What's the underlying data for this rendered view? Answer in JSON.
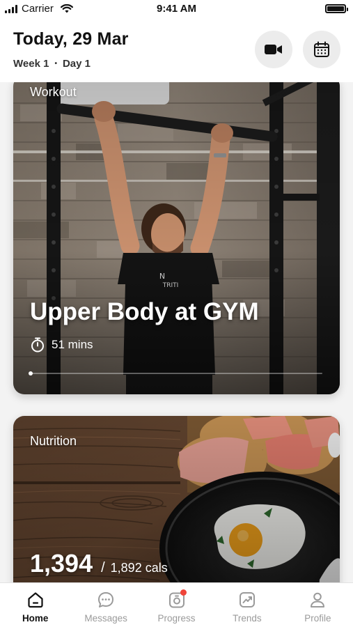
{
  "status_bar": {
    "carrier": "Carrier",
    "time": "9:41 AM"
  },
  "header": {
    "title": "Today, 29 Mar",
    "week": "Week 1",
    "separator": "•",
    "day": "Day 1"
  },
  "workout_card": {
    "label": "Workout",
    "title": "Upper Body at GYM",
    "duration": "51 mins",
    "progress": 0
  },
  "nutrition_card": {
    "label": "Nutrition",
    "calories": "1,394",
    "separator": "/",
    "target": "1,892 cals"
  },
  "tabs": [
    {
      "label": "Home",
      "icon": "home-icon",
      "active": true
    },
    {
      "label": "Messages",
      "icon": "messages-icon",
      "active": false
    },
    {
      "label": "Progress",
      "icon": "progress-icon",
      "active": false,
      "badge": true
    },
    {
      "label": "Trends",
      "icon": "trends-icon",
      "active": false
    },
    {
      "label": "Profile",
      "icon": "profile-icon",
      "active": false
    }
  ],
  "colors": {
    "badge": "#f0453a",
    "active_tab": "#111111",
    "inactive_tab": "#9a9a9a"
  }
}
